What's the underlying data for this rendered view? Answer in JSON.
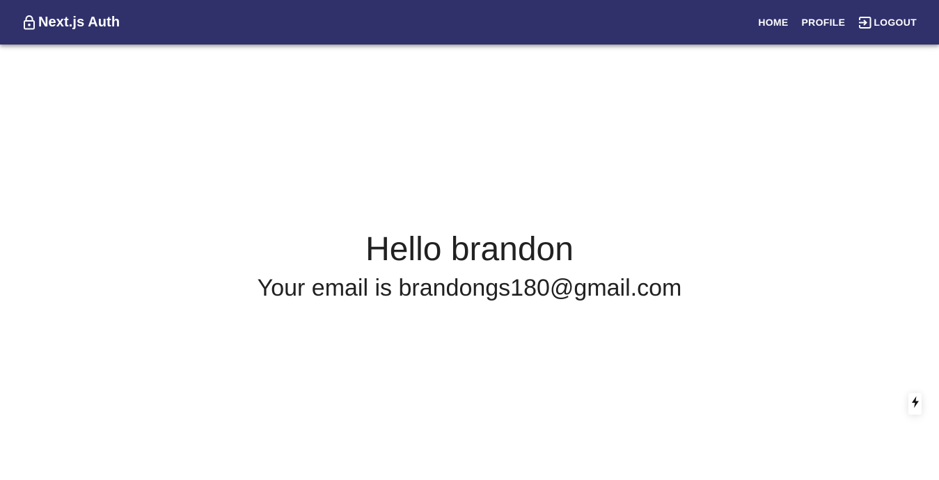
{
  "header": {
    "brand_icon": "lock-open-icon",
    "brand_title": "Next.js Auth",
    "background_color": "#30316b",
    "nav": {
      "home_label": "HOME",
      "profile_label": "PROFILE",
      "logout_icon": "login-arrow-icon",
      "logout_label": "LOGOUT"
    }
  },
  "main": {
    "greeting": "Hello brandon",
    "email_line": "Your email is brandongs180@gmail.com",
    "text_color": "#212121"
  },
  "next_indicator": {
    "icon": "lightning-bolt-icon"
  }
}
